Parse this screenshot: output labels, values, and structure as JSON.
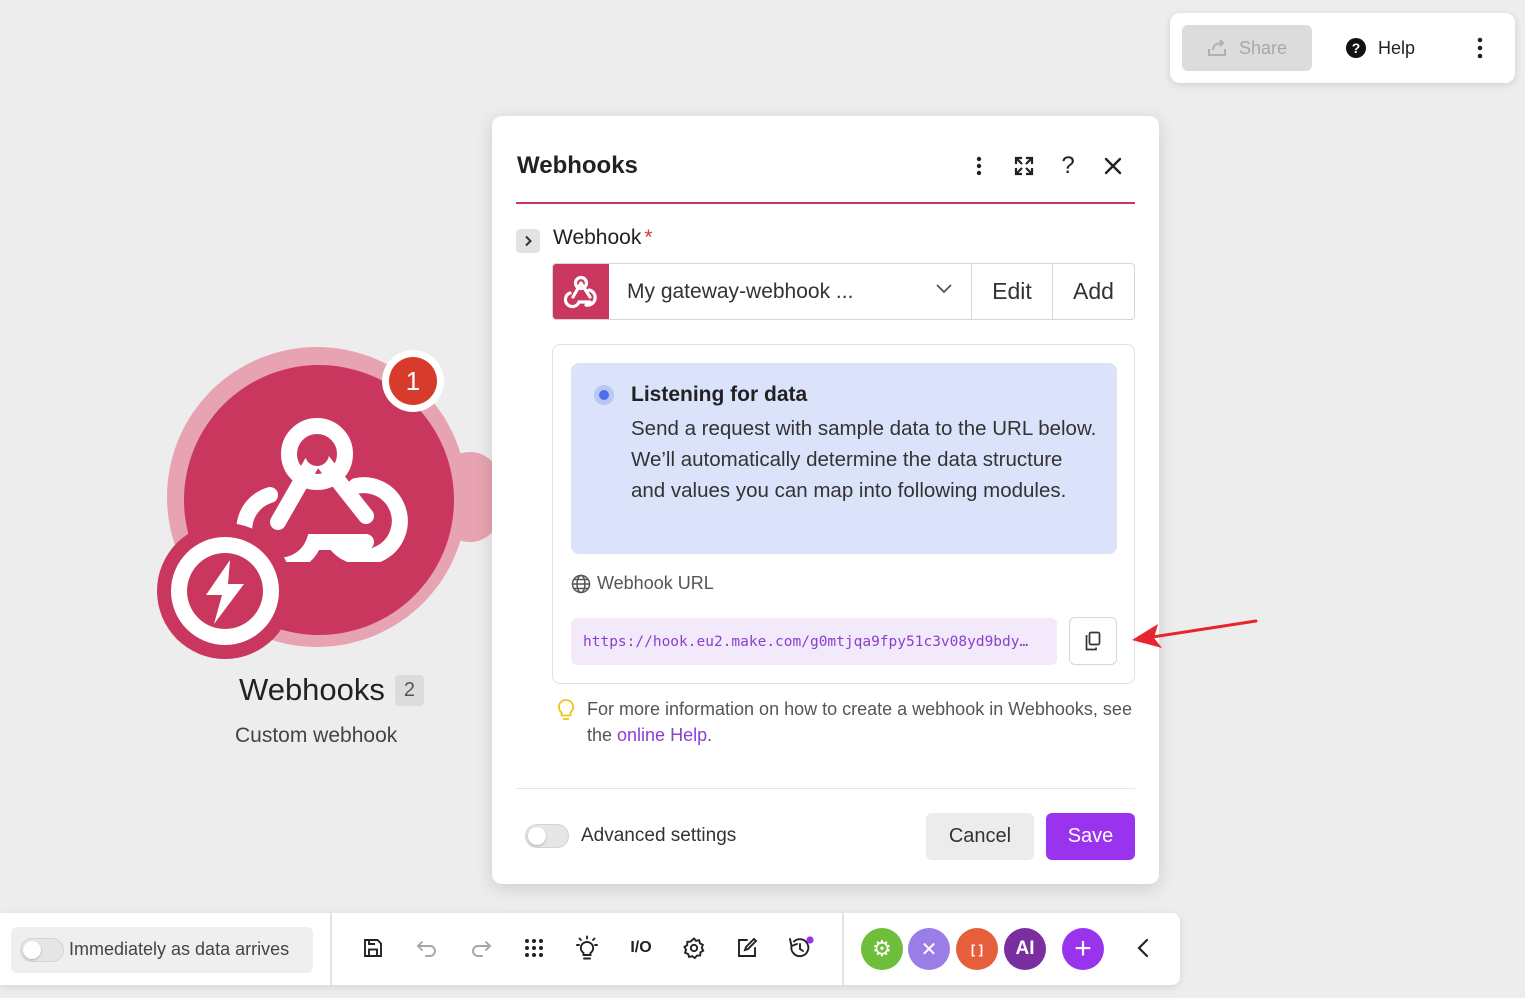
{
  "topbar": {
    "share_label": "Share",
    "help_label": "Help",
    "help_glyph": "?",
    "more_icon": "more-vertical-icon"
  },
  "module": {
    "title": "Webhooks",
    "count": "2",
    "subtitle": "Custom webhook",
    "error_count": "1",
    "colors": {
      "primary": "#c9365e",
      "ring": "#e7a3b2"
    }
  },
  "dialog": {
    "title": "Webhooks",
    "icons": [
      "more-vertical-icon",
      "expand-icon",
      "help-icon",
      "close-icon"
    ],
    "help_glyph": "?",
    "field": {
      "label": "Webhook",
      "required_mark": "*",
      "selected_value": "My gateway-webhook ...",
      "edit_label": "Edit",
      "add_label": "Add"
    },
    "listening": {
      "title": "Listening for data",
      "text": "Send a request with sample data to the URL below. We’ll automatically determine the data structure and values you can map into following modules."
    },
    "webhook_url": {
      "label": "Webhook URL",
      "value": "https://hook.eu2.make.com/g0mtjqa9fpy51c3v08yd9bdy…"
    },
    "tip": {
      "text_before": "For more information on how to create a webhook in Webhooks, see the ",
      "link_text": "online Help",
      "text_after": "."
    },
    "footer": {
      "advanced_label": "Advanced settings",
      "advanced_enabled": false,
      "cancel_label": "Cancel",
      "save_label": "Save"
    },
    "colors": {
      "accent": "#9933ee",
      "separator": "#c9365e",
      "listen_bg": "#dbe3fb"
    }
  },
  "bottombar": {
    "schedule_label": "Immediately as data arrives",
    "schedule_enabled": false,
    "tools": [
      "save-icon",
      "undo-icon",
      "redo-icon",
      "grid-icon",
      "lightbulb-icon",
      "io-icon",
      "settings-icon",
      "notes-icon",
      "history-icon"
    ],
    "io_text": "I/O",
    "apps": [
      {
        "name": "tools-app",
        "color": "#6ebd3b",
        "text": "⚙"
      },
      {
        "name": "flow-control-app",
        "color": "#9b7de8",
        "text": "✕"
      },
      {
        "name": "text-parser-app",
        "color": "#e55f3a",
        "text": "[ ]"
      },
      {
        "name": "ai-app",
        "color": "#7b2ea0",
        "text": "AI"
      },
      {
        "name": "add-app",
        "color": "#9933ee",
        "text": "+"
      }
    ],
    "collapse_icon": "chevron-left-icon"
  }
}
